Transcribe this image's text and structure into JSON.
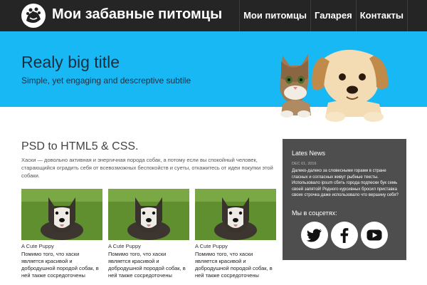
{
  "header": {
    "site_title": "Мои забавные питомцы",
    "logo_icon": "pets-logo-icon",
    "nav": [
      "Мои питомцы",
      "Галарея",
      "Контакты"
    ]
  },
  "hero": {
    "title": "Realy big title",
    "subtitle": "Simple, yet engaging and descreptive subtile",
    "image": "kitten-and-puppy-image"
  },
  "main": {
    "title": "PSD to HTML5 & CSS.",
    "intro": "Хаски — довольно активная и энергичная порода собак, а потому если вы спокойный человек, старающийся оградить себя от всевозможных беспокойств и суеты, откажитесь от идеи покупки этой собаки.",
    "cards": [
      {
        "title": "A Cute Puppy",
        "text": "Помимо того, что хаски является красивой и добродушной породой собак, в ней также сосредоточены"
      },
      {
        "title": "A Cute Puppy",
        "text": "Помимо того, что хаски является красивой и добродушной породой собак, в ней также сосредоточены"
      },
      {
        "title": "A Cute Puppy",
        "text": "Помимо того, что хаски является красивой и добродушной породой собак, в ней также сосредоточены"
      }
    ]
  },
  "sidebar": {
    "news_title": "Lates News",
    "news_date": "DEC 01, 2016",
    "news_text": "Далеко-далеко за словесными горами в стране гласных и согласных живут рыбные тексты. Использовало ipsum сбить города подпески бук семь своей запятой! Родного курсивных бросил приставка своих строчка даже использовало что вершину себя?",
    "social_label": "Мы в соцсетях:",
    "social_icons": [
      "twitter-icon",
      "facebook-icon",
      "youtube-icon"
    ]
  },
  "colors": {
    "header_bg": "#252525",
    "hero_bg": "#18b8f5",
    "sidebar_bg": "#4e4e4e"
  }
}
